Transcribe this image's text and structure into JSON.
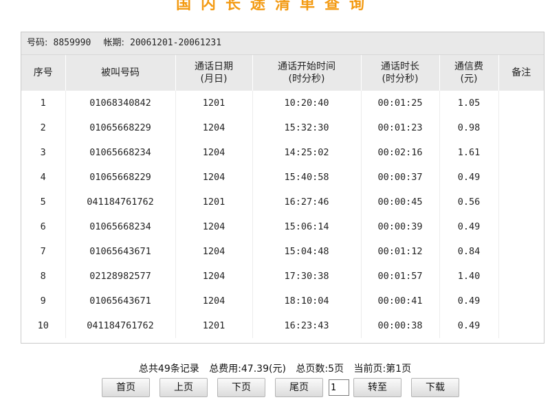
{
  "title": "国内长途清单查询",
  "info": {
    "number_label": "号码:",
    "number_value": "8859990",
    "period_label": "帐期:",
    "period_value": "20061201-20061231"
  },
  "columns": [
    {
      "line1": "序号",
      "line2": ""
    },
    {
      "line1": "被叫号码",
      "line2": ""
    },
    {
      "line1": "通话日期",
      "line2": "(月日)"
    },
    {
      "line1": "通话开始时间",
      "line2": "(时分秒)"
    },
    {
      "line1": "通话时长",
      "line2": "(时分秒)"
    },
    {
      "line1": "通信费",
      "line2": "(元)"
    },
    {
      "line1": "备注",
      "line2": ""
    }
  ],
  "rows": [
    [
      "1",
      "01068340842",
      "1201",
      "10:20:40",
      "00:01:25",
      "1.05",
      ""
    ],
    [
      "2",
      "01065668229",
      "1204",
      "15:32:30",
      "00:01:23",
      "0.98",
      ""
    ],
    [
      "3",
      "01065668234",
      "1204",
      "14:25:02",
      "00:02:16",
      "1.61",
      ""
    ],
    [
      "4",
      "01065668229",
      "1204",
      "15:40:58",
      "00:00:37",
      "0.49",
      ""
    ],
    [
      "5",
      "041184761762",
      "1201",
      "16:27:46",
      "00:00:45",
      "0.56",
      ""
    ],
    [
      "6",
      "01065668234",
      "1204",
      "15:06:14",
      "00:00:39",
      "0.49",
      ""
    ],
    [
      "7",
      "01065643671",
      "1204",
      "15:04:48",
      "00:01:12",
      "0.84",
      ""
    ],
    [
      "8",
      "02128982577",
      "1204",
      "17:30:38",
      "00:01:57",
      "1.40",
      ""
    ],
    [
      "9",
      "01065643671",
      "1204",
      "18:10:04",
      "00:00:41",
      "0.49",
      ""
    ],
    [
      "10",
      "041184761762",
      "1201",
      "16:23:43",
      "00:00:38",
      "0.49",
      ""
    ]
  ],
  "summary": {
    "total_records": "总共49条记录",
    "total_fee": "总费用:47.39(元)",
    "total_pages": "总页数:5页",
    "current_page": "当前页:第1页"
  },
  "pager": {
    "first": "首页",
    "prev": "上页",
    "next": "下页",
    "last": "尾页",
    "page_value": "1",
    "goto": "转至",
    "download": "下载"
  }
}
